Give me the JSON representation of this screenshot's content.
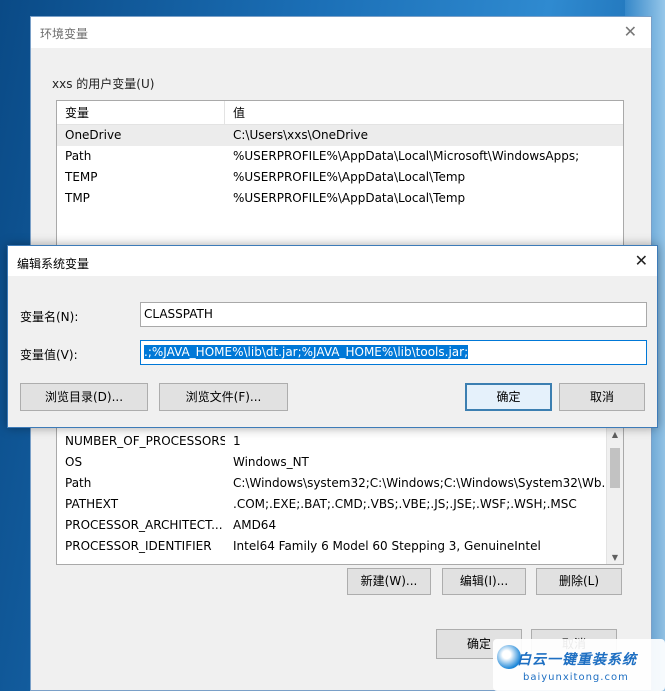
{
  "env_window": {
    "title": "环境变量",
    "close_icon": "close-icon",
    "user_group_label": "xxs 的用户变量(U)",
    "columns": {
      "variable": "变量",
      "value": "值"
    },
    "user_vars": [
      {
        "name": "OneDrive",
        "value": "C:\\Users\\xxs\\OneDrive"
      },
      {
        "name": "Path",
        "value": "%USERPROFILE%\\AppData\\Local\\Microsoft\\WindowsApps;"
      },
      {
        "name": "TEMP",
        "value": "%USERPROFILE%\\AppData\\Local\\Temp"
      },
      {
        "name": "TMP",
        "value": "%USERPROFILE%\\AppData\\Local\\Temp"
      }
    ],
    "system_vars": [
      {
        "name": "NUMBER_OF_PROCESSORS",
        "value": "1"
      },
      {
        "name": "OS",
        "value": "Windows_NT"
      },
      {
        "name": "Path",
        "value": "C:\\Windows\\system32;C:\\Windows;C:\\Windows\\System32\\Wb..."
      },
      {
        "name": "PATHEXT",
        "value": ".COM;.EXE;.BAT;.CMD;.VBS;.VBE;.JS;.JSE;.WSF;.WSH;.MSC"
      },
      {
        "name": "PROCESSOR_ARCHITECT...",
        "value": "AMD64"
      },
      {
        "name": "PROCESSOR_IDENTIFIER",
        "value": "Intel64 Family 6 Model 60 Stepping 3, GenuineIntel"
      }
    ],
    "buttons": {
      "new": "新建(W)...",
      "edit": "编辑(I)...",
      "delete": "删除(L)",
      "ok": "确定",
      "cancel": "取消"
    }
  },
  "edit_dialog": {
    "title": "编辑系统变量",
    "name_label": "变量名(N):",
    "name_value": "CLASSPATH",
    "value_label": "变量值(V):",
    "value_value": ".;%JAVA_HOME%\\lib\\dt.jar;%JAVA_HOME%\\lib\\tools.jar;",
    "buttons": {
      "browse_dir": "浏览目录(D)...",
      "browse_file": "浏览文件(F)...",
      "ok": "确定",
      "cancel": "取消"
    }
  },
  "watermark": {
    "title": "白云一键重装系统",
    "url": "baiyunxitong.com"
  },
  "colors": {
    "accent": "#0078d7",
    "desktop": "#1b6fb6"
  }
}
